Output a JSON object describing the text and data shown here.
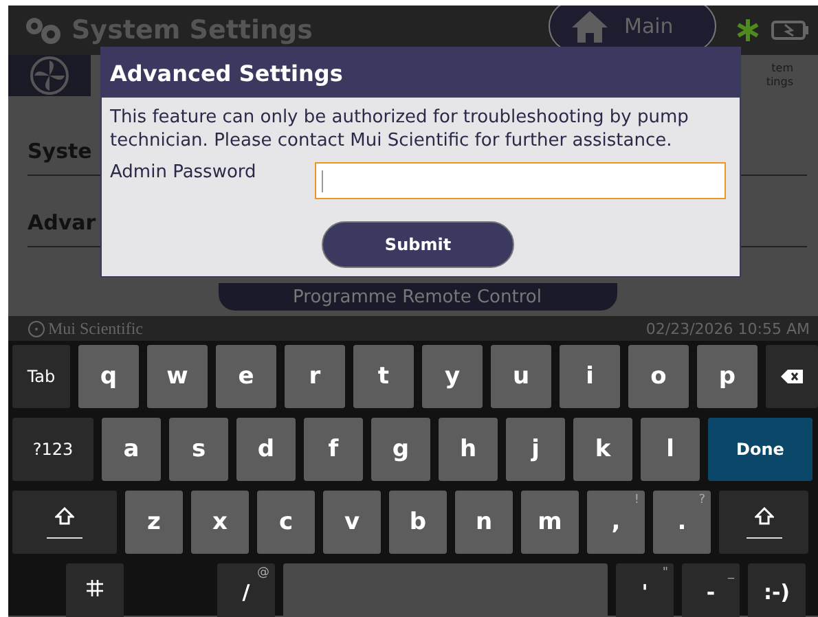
{
  "header": {
    "title": "System Settings",
    "main_button": "Main"
  },
  "tab": {
    "label_lines": [
      "tem",
      "tings"
    ]
  },
  "background_sections": [
    "Syste",
    "Advar"
  ],
  "remote_button": "Programme Remote Control",
  "status_bar": {
    "brand": "Mui Scientific",
    "datetime": "02/23/2026 10:55 AM"
  },
  "dialog": {
    "title": "Advanced Settings",
    "message": "This feature can only be authorized for troubleshooting by pump technician. Please contact Mui Scientific for further assistance.",
    "field_label": "Admin Password",
    "submit": "Submit"
  },
  "keyboard": {
    "rows": [
      [
        {
          "kind": "function",
          "label": "Tab"
        },
        {
          "kind": "letter",
          "label": "q"
        },
        {
          "kind": "letter",
          "label": "w"
        },
        {
          "kind": "letter",
          "label": "e"
        },
        {
          "kind": "letter",
          "label": "r"
        },
        {
          "kind": "letter",
          "label": "t"
        },
        {
          "kind": "letter",
          "label": "y"
        },
        {
          "kind": "letter",
          "label": "u"
        },
        {
          "kind": "letter",
          "label": "i"
        },
        {
          "kind": "letter",
          "label": "o"
        },
        {
          "kind": "letter",
          "label": "p"
        },
        {
          "kind": "backspace"
        }
      ],
      [
        {
          "kind": "function",
          "label": "?123"
        },
        {
          "kind": "letter",
          "label": "a"
        },
        {
          "kind": "letter",
          "label": "s"
        },
        {
          "kind": "letter",
          "label": "d"
        },
        {
          "kind": "letter",
          "label": "f"
        },
        {
          "kind": "letter",
          "label": "g"
        },
        {
          "kind": "letter",
          "label": "h"
        },
        {
          "kind": "letter",
          "label": "j"
        },
        {
          "kind": "letter",
          "label": "k"
        },
        {
          "kind": "letter",
          "label": "l"
        },
        {
          "kind": "action",
          "label": "Done"
        }
      ],
      [
        {
          "kind": "shift"
        },
        {
          "kind": "letter",
          "label": "z"
        },
        {
          "kind": "letter",
          "label": "x"
        },
        {
          "kind": "letter",
          "label": "c"
        },
        {
          "kind": "letter",
          "label": "v"
        },
        {
          "kind": "letter",
          "label": "b"
        },
        {
          "kind": "letter",
          "label": "n"
        },
        {
          "kind": "letter",
          "label": "m"
        },
        {
          "kind": "letter",
          "label": ",",
          "hint": "!"
        },
        {
          "kind": "letter",
          "label": ".",
          "hint": "?"
        },
        {
          "kind": "shift"
        }
      ],
      [
        {
          "kind": "gap"
        },
        {
          "kind": "settings"
        },
        {
          "kind": "gap"
        },
        {
          "kind": "symbol",
          "label": "/",
          "hint": "@"
        },
        {
          "kind": "space"
        },
        {
          "kind": "symbol",
          "label": "'",
          "hint": "\""
        },
        {
          "kind": "symbol",
          "label": "-",
          "hint": "_"
        },
        {
          "kind": "symbol",
          "label": ":-)"
        }
      ]
    ]
  }
}
